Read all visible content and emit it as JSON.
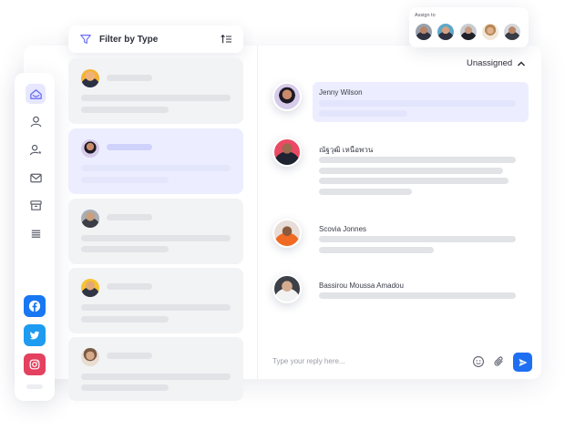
{
  "filter": {
    "label": "Filter by Type"
  },
  "header": {
    "status_label": "Unassigned"
  },
  "assign": {
    "label": "Assign to"
  },
  "messages": [
    {
      "name": "Jenny Wilson"
    },
    {
      "name": "ณัฐวุฒิ เหนือพวน"
    },
    {
      "name": "Scovia Jonnes"
    },
    {
      "name": "Bassirou Moussa Amadou"
    }
  ],
  "reply": {
    "placeholder": "Type your reply here..."
  },
  "colors": {
    "accent": "#1f6ff2",
    "selected_bg": "#eceeff",
    "facebook": "#1877f2",
    "twitter": "#1d9bf0",
    "instagram": "#e4405f"
  }
}
